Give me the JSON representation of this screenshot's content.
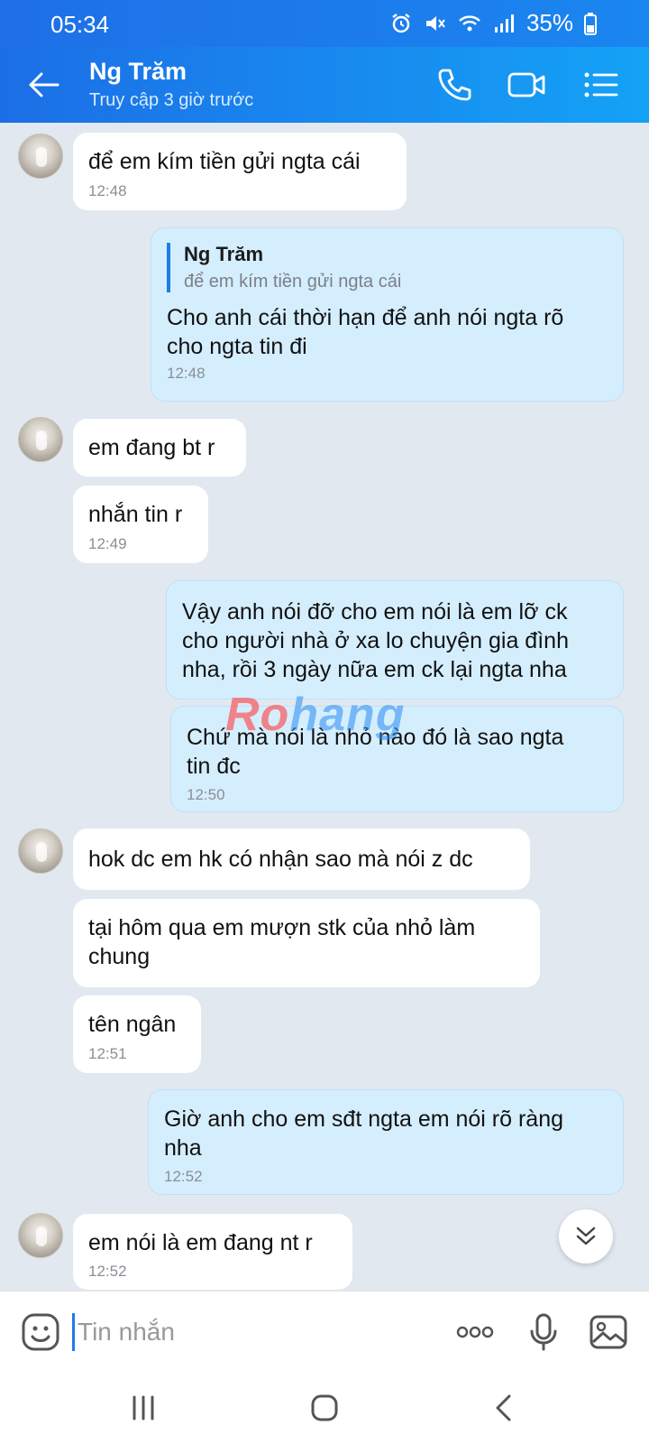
{
  "status_bar": {
    "time": "05:34",
    "battery": "35%"
  },
  "header": {
    "contact_name": "Ng Trăm",
    "last_seen": "Truy cập 3 giờ trước"
  },
  "messages": [
    {
      "dir": "in",
      "text": "để em kím tiền gửi ngta cái",
      "time": "12:48"
    },
    {
      "dir": "out",
      "quote_name": "Ng Trăm",
      "quote_text": "để em kím tiền gửi ngta cái",
      "text_line1": "Cho anh cái thời hạn để anh nói ngta rõ",
      "text_line2": "cho ngta tin đi",
      "time": "12:48"
    },
    {
      "dir": "in",
      "text": "em đang bt r"
    },
    {
      "dir": "in",
      "text": "nhắn tin r",
      "time": "12:49"
    },
    {
      "dir": "out",
      "text_line1": "Vậy anh nói đỡ cho em nói là em lỡ ck",
      "text_line2": "cho người nhà ở xa lo chuyện gia đình",
      "text_line3": "nha, rồi 3 ngày nữa em ck lại ngta nha"
    },
    {
      "dir": "out",
      "text_line1": "Chứ mà nói là nhỏ nào đó là sao ngta",
      "text_line2": "tin đc",
      "time": "12:50"
    },
    {
      "dir": "in",
      "text": "hok dc em hk có nhận sao mà nói z dc"
    },
    {
      "dir": "in",
      "text_line1": "tại hôm qua em mượn stk của nhỏ làm",
      "text_line2": "chung"
    },
    {
      "dir": "in",
      "text": "tên ngân",
      "time": "12:51"
    },
    {
      "dir": "out",
      "text_line1": "Giờ anh cho em sđt ngta em nói rõ ràng",
      "text_line2": "nha",
      "time": "12:52"
    },
    {
      "dir": "in",
      "text": "em nói là em đang nt r",
      "time": "12:52"
    }
  ],
  "watermark": {
    "part1": "Ro",
    "part2": "hang"
  },
  "composer": {
    "placeholder": "Tin nhắn"
  },
  "colors": {
    "header": "#1c6ee6",
    "outgoing_bubble": "#d5eefe",
    "incoming_bubble": "#ffffff",
    "background": "#e1e8f0"
  },
  "icons": [
    "back-arrow-icon",
    "phone-icon",
    "video-call-icon",
    "menu-list-icon",
    "emoji-icon",
    "more-icon",
    "microphone-icon",
    "image-icon",
    "recent-apps-icon",
    "home-icon",
    "nav-back-icon",
    "chevron-down-icon"
  ]
}
